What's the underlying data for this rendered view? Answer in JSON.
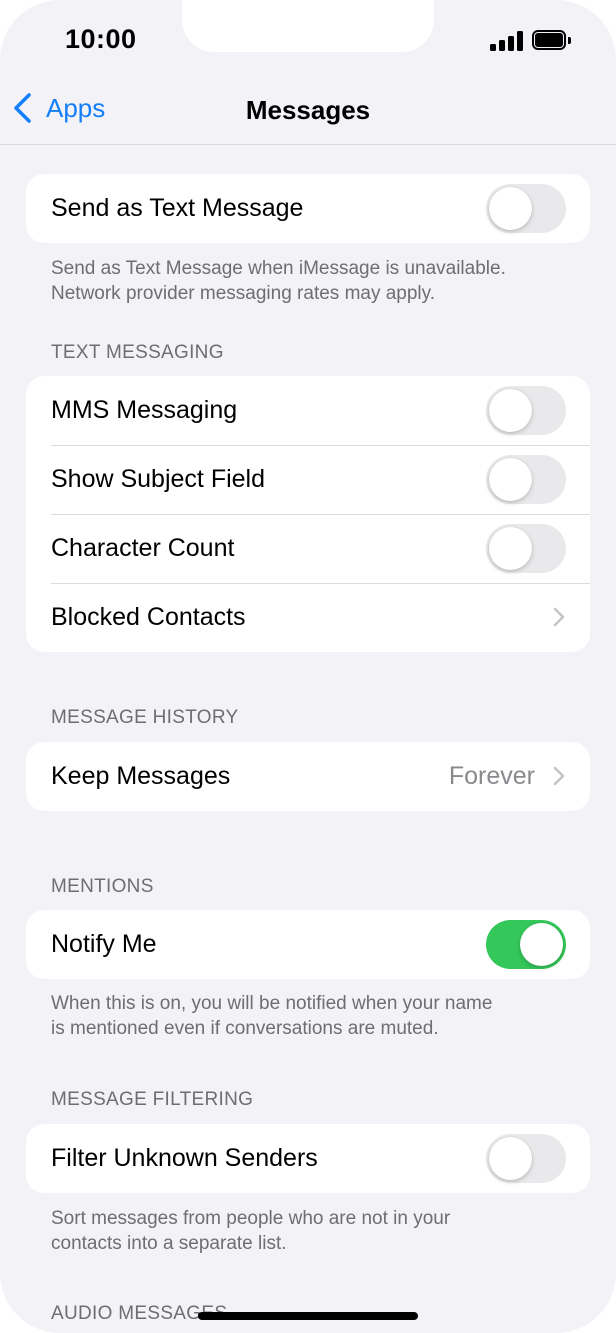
{
  "status_bar": {
    "time": "10:00",
    "signal_icon": "cellular-signal-icon",
    "battery_icon": "battery-full-icon"
  },
  "nav": {
    "back_label": "Apps",
    "back_icon": "chevron-left-icon",
    "title": "Messages"
  },
  "groups": {
    "send_as_text": {
      "label": "Send as Text Message",
      "toggle_on": false,
      "footer_line1": "Send as Text Message when iMessage is unavailable.",
      "footer_line2": "Network provider messaging rates may apply."
    },
    "text_messaging": {
      "header": "TEXT MESSAGING",
      "rows": [
        {
          "label": "MMS Messaging",
          "toggle_on": false
        },
        {
          "label": "Show Subject Field",
          "toggle_on": false
        },
        {
          "label": "Character Count",
          "toggle_on": false
        },
        {
          "label": "Blocked Contacts",
          "chevron_icon": "chevron-right-icon"
        }
      ]
    },
    "message_history": {
      "header": "MESSAGE HISTORY",
      "rows": [
        {
          "label": "Keep Messages",
          "value": "Forever",
          "chevron_icon": "chevron-right-icon"
        }
      ]
    },
    "mentions": {
      "header": "MENTIONS",
      "rows": [
        {
          "label": "Notify Me",
          "toggle_on": true
        }
      ],
      "footer_line1": "When this is on, you will be notified when your name",
      "footer_line2": "is mentioned even if conversations are muted."
    },
    "message_filtering": {
      "header": "MESSAGE FILTERING",
      "rows": [
        {
          "label": "Filter Unknown Senders",
          "toggle_on": false
        }
      ],
      "footer_line1": "Sort messages from people who are not in your",
      "footer_line2": "contacts into a separate list."
    },
    "audio_messages": {
      "header": "AUDIO MESSAGES"
    }
  },
  "colors": {
    "accent": "#147efb",
    "toggle_on": "#34c759",
    "toggle_off": "#e9e9eb",
    "background": "#f2f2f7"
  }
}
